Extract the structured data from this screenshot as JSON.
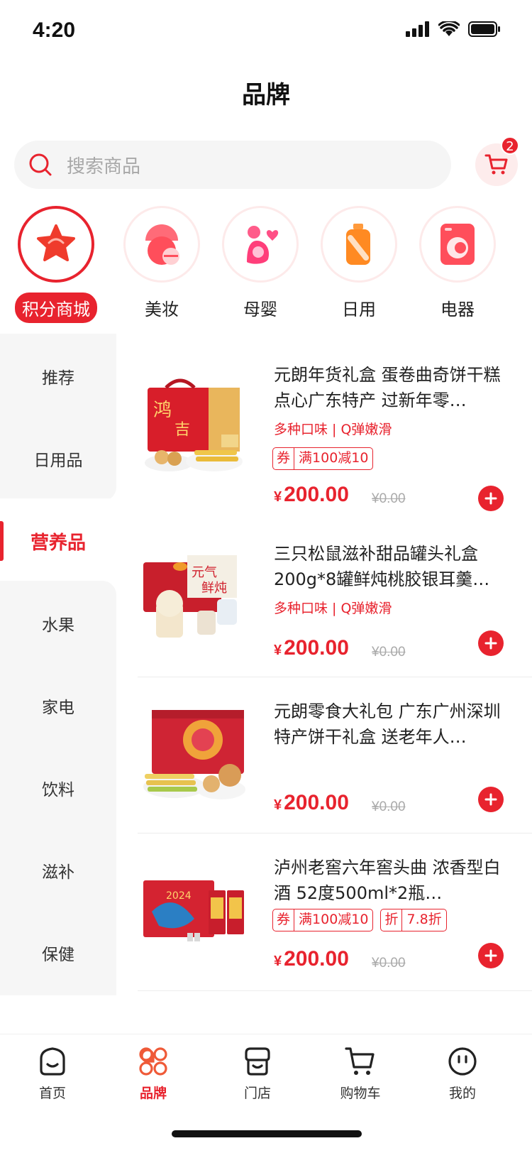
{
  "status": {
    "time": "4:20"
  },
  "header": {
    "title": "品牌"
  },
  "search": {
    "placeholder": "搜索商品",
    "cart_count": "2"
  },
  "categories": [
    {
      "label": "积分商城",
      "icon": "star-icon",
      "active": true
    },
    {
      "label": "美妆",
      "icon": "cosmetics-icon",
      "active": false
    },
    {
      "label": "母婴",
      "icon": "mother-baby-icon",
      "active": false
    },
    {
      "label": "日用",
      "icon": "daily-bottle-icon",
      "active": false
    },
    {
      "label": "电器",
      "icon": "washing-machine-icon",
      "active": false
    }
  ],
  "sidebar": {
    "items": [
      {
        "label": "推荐"
      },
      {
        "label": "日用品"
      },
      {
        "label": "营养品",
        "active": true
      },
      {
        "label": "水果"
      },
      {
        "label": "家电"
      },
      {
        "label": "饮料"
      },
      {
        "label": "滋补"
      },
      {
        "label": "保健"
      }
    ]
  },
  "products": [
    {
      "title": "元朗年货礼盒  蛋卷曲奇饼干糕点心广东特产 过新年零…",
      "subtitle": "多种口味 | Q弹嫩滑",
      "tags": [
        {
          "key": "券",
          "value": "满100减10"
        }
      ],
      "currency": "¥",
      "price": "200.00",
      "old_price": "¥0.00"
    },
    {
      "title": "三只松鼠滋补甜品罐头礼盒200g*8罐鲜炖桃胶银耳羹…",
      "subtitle": "多种口味 | Q弹嫩滑",
      "tags": [],
      "currency": "¥",
      "price": "200.00",
      "old_price": "¥0.00"
    },
    {
      "title": "元朗零食大礼包  广东广州深圳特产饼干礼盒 送老年人…",
      "subtitle": "",
      "tags": [],
      "currency": "¥",
      "price": "200.00",
      "old_price": "¥0.00"
    },
    {
      "title": "泸州老窖六年窖头曲  浓香型白酒 52度500ml*2瓶…",
      "subtitle": "",
      "tags": [
        {
          "key": "券",
          "value": "满100减10"
        },
        {
          "key": "折",
          "value": "7.8折"
        }
      ],
      "currency": "¥",
      "price": "200.00",
      "old_price": "¥0.00"
    }
  ],
  "tabbar": [
    {
      "label": "首页",
      "icon": "home-smile-icon",
      "active": false
    },
    {
      "label": "品牌",
      "icon": "brand-grid-icon",
      "active": true
    },
    {
      "label": "门店",
      "icon": "store-icon",
      "active": false
    },
    {
      "label": "购物车",
      "icon": "cart-icon",
      "active": false
    },
    {
      "label": "我的",
      "icon": "profile-face-icon",
      "active": false
    }
  ],
  "colors": {
    "accent": "#e8232e",
    "sidebar_bg": "#f6f6f6",
    "search_bg": "#f5f5f5"
  }
}
